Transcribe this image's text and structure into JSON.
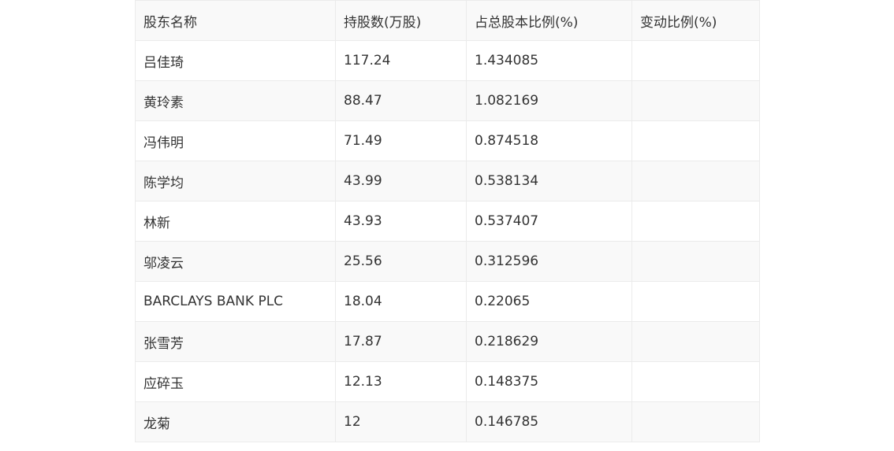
{
  "table": {
    "headers": [
      "股东名称",
      "持股数(万股)",
      "占总股本比例(%)",
      "变动比例(%)"
    ],
    "rows": [
      [
        "吕佳琦",
        "117.24",
        "1.434085",
        ""
      ],
      [
        "黄玲素",
        "88.47",
        "1.082169",
        ""
      ],
      [
        "冯伟明",
        "71.49",
        "0.874518",
        ""
      ],
      [
        "陈学均",
        "43.99",
        "0.538134",
        ""
      ],
      [
        "林新",
        "43.93",
        "0.537407",
        ""
      ],
      [
        "邬凌云",
        "25.56",
        "0.312596",
        ""
      ],
      [
        "BARCLAYS BANK PLC",
        "18.04",
        "0.22065",
        ""
      ],
      [
        "张雪芳",
        "17.87",
        "0.218629",
        ""
      ],
      [
        "应碎玉",
        "12.13",
        "0.148375",
        ""
      ],
      [
        "龙菊",
        "12",
        "0.146785",
        ""
      ]
    ]
  }
}
